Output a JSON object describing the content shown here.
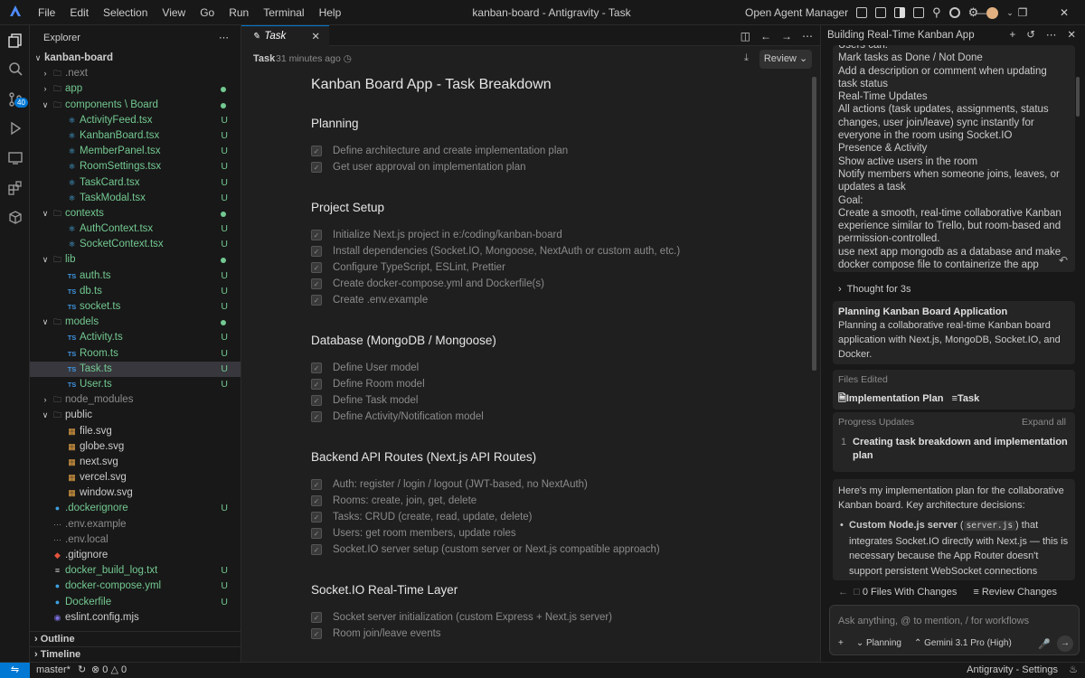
{
  "menu": [
    "File",
    "Edit",
    "Selection",
    "View",
    "Go",
    "Run",
    "Terminal",
    "Help"
  ],
  "window_title": "kanban-board - Antigravity - Task",
  "agent_manager_label": "Open Agent Manager",
  "scm_badge": "40",
  "explorer": {
    "title": "Explorer",
    "root": "kanban-board",
    "items": [
      {
        "label": ".next",
        "kind": "folder",
        "status": ""
      },
      {
        "label": "app",
        "kind": "folder",
        "status": "dot"
      },
      {
        "label": "components \\ Board",
        "kind": "folder-open",
        "status": "dot"
      },
      {
        "label": "ActivityFeed.tsx",
        "kind": "react",
        "status": "U"
      },
      {
        "label": "KanbanBoard.tsx",
        "kind": "react",
        "status": "U"
      },
      {
        "label": "MemberPanel.tsx",
        "kind": "react",
        "status": "U"
      },
      {
        "label": "RoomSettings.tsx",
        "kind": "react",
        "status": "U"
      },
      {
        "label": "TaskCard.tsx",
        "kind": "react",
        "status": "U"
      },
      {
        "label": "TaskModal.tsx",
        "kind": "react",
        "status": "U"
      },
      {
        "label": "contexts",
        "kind": "folder-open",
        "status": "dot"
      },
      {
        "label": "AuthContext.tsx",
        "kind": "react",
        "status": "U"
      },
      {
        "label": "SocketContext.tsx",
        "kind": "react",
        "status": "U"
      },
      {
        "label": "lib",
        "kind": "folder-open",
        "status": "dot"
      },
      {
        "label": "auth.ts",
        "kind": "ts",
        "status": "U"
      },
      {
        "label": "db.ts",
        "kind": "ts",
        "status": "U"
      },
      {
        "label": "socket.ts",
        "kind": "ts",
        "status": "U"
      },
      {
        "label": "models",
        "kind": "folder-open",
        "status": "dot"
      },
      {
        "label": "Activity.ts",
        "kind": "ts",
        "status": "U"
      },
      {
        "label": "Room.ts",
        "kind": "ts",
        "status": "U"
      },
      {
        "label": "Task.ts",
        "kind": "ts",
        "status": "U"
      },
      {
        "label": "User.ts",
        "kind": "ts",
        "status": "U"
      },
      {
        "label": "node_modules",
        "kind": "folder",
        "status": ""
      },
      {
        "label": "public",
        "kind": "folder-open",
        "status": ""
      },
      {
        "label": "file.svg",
        "kind": "svg",
        "status": ""
      },
      {
        "label": "globe.svg",
        "kind": "svg",
        "status": ""
      },
      {
        "label": "next.svg",
        "kind": "svg",
        "status": ""
      },
      {
        "label": "vercel.svg",
        "kind": "svg",
        "status": ""
      },
      {
        "label": "window.svg",
        "kind": "svg",
        "status": ""
      },
      {
        "label": ".dockerignore",
        "kind": "docker",
        "status": "U"
      },
      {
        "label": ".env.example",
        "kind": "plain",
        "status": ""
      },
      {
        "label": ".env.local",
        "kind": "plain",
        "status": ""
      },
      {
        "label": ".gitignore",
        "kind": "git",
        "status": ""
      },
      {
        "label": "docker_build_log.txt",
        "kind": "text",
        "status": "U"
      },
      {
        "label": "docker-compose.yml",
        "kind": "docker",
        "status": "U"
      },
      {
        "label": "Dockerfile",
        "kind": "docker",
        "status": "U"
      },
      {
        "label": "eslint.config.mjs",
        "kind": "eslint",
        "status": ""
      }
    ],
    "outline": "Outline",
    "timeline": "Timeline"
  },
  "editor": {
    "tab_label": "Task",
    "doc_label": "Task",
    "doc_time": "31 minutes ago",
    "review_label": "Review",
    "title": "Kanban Board App - Task Breakdown",
    "sections": [
      {
        "heading": "Planning",
        "tasks": [
          "Define architecture and create implementation plan",
          "Get user approval on implementation plan"
        ]
      },
      {
        "heading": "Project Setup",
        "tasks": [
          "Initialize Next.js project in e:/coding/kanban-board",
          "Install dependencies (Socket.IO, Mongoose, NextAuth or custom auth, etc.)",
          "Configure TypeScript, ESLint, Prettier",
          "Create docker-compose.yml and Dockerfile(s)",
          "Create .env.example"
        ]
      },
      {
        "heading": "Database (MongoDB / Mongoose)",
        "tasks": [
          "Define User model",
          "Define Room model",
          "Define Task model",
          "Define Activity/Notification model"
        ]
      },
      {
        "heading": "Backend API Routes (Next.js API Routes)",
        "tasks": [
          "Auth: register / login / logout (JWT-based, no NextAuth)",
          "Rooms: create, join, get, delete",
          "Tasks: CRUD (create, read, update, delete)",
          "Users: get room members, update roles",
          "Socket.IO server setup (custom server or Next.js compatible approach)"
        ]
      },
      {
        "heading": "Socket.IO Real-Time Layer",
        "tasks": [
          "Socket server initialization (custom Express + Next.js server)",
          "Room join/leave events"
        ]
      }
    ]
  },
  "agent": {
    "title": "Building Real-Time Kanban App",
    "user_message_lines": [
      "Users can:",
      "Mark tasks as Done / Not Done",
      "Add a description or comment when updating",
      "task status",
      "Real-Time Updates",
      "All actions (task updates, assignments, status",
      "changes, user join/leave) sync instantly for",
      "everyone in the room using Socket.IO",
      "Presence & Activity",
      "Show active users in the room",
      "Notify members when someone joins, leaves, or",
      "updates a task",
      "Goal:",
      "Create a smooth, real-time collaborative Kanban",
      "experience similar to Trello, but room-based and",
      "permission-controlled.",
      "use next app mongodb as a database and make",
      "docker compose file to containerize the app"
    ],
    "thought": "Thought for 3s",
    "plan_title": "Planning Kanban Board Application",
    "plan_text": "Planning a collaborative real-time Kanban board application with Next.js, MongoDB, Socket.IO, and Docker.",
    "files_edited_label": "Files Edited",
    "file1": "Implementation Plan",
    "file2": "Task",
    "progress_label": "Progress Updates",
    "expand_all": "Expand all",
    "progress_num": "1",
    "progress_item": "Creating task breakdown and implementation plan",
    "reply_intro": "Here's my implementation plan for the collaborative Kanban board. Key architecture decisions:",
    "bullet_bold": "Custom Node.js server",
    "bullet_code": "server.js",
    "bullet_rest": "that integrates Socket.IO directly with Next.js — this is necessary because the App Router doesn't support persistent WebSocket connections natively",
    "files_changes": "0 Files With Changes",
    "review_changes": "Review Changes",
    "input_placeholder": "Ask anything, @ to mention, / for workflows",
    "mode": "Planning",
    "model": "Gemini 3.1 Pro (High)"
  },
  "status": {
    "branch": "master*",
    "errors": "0",
    "warnings": "0",
    "right": "Antigravity - Settings"
  }
}
